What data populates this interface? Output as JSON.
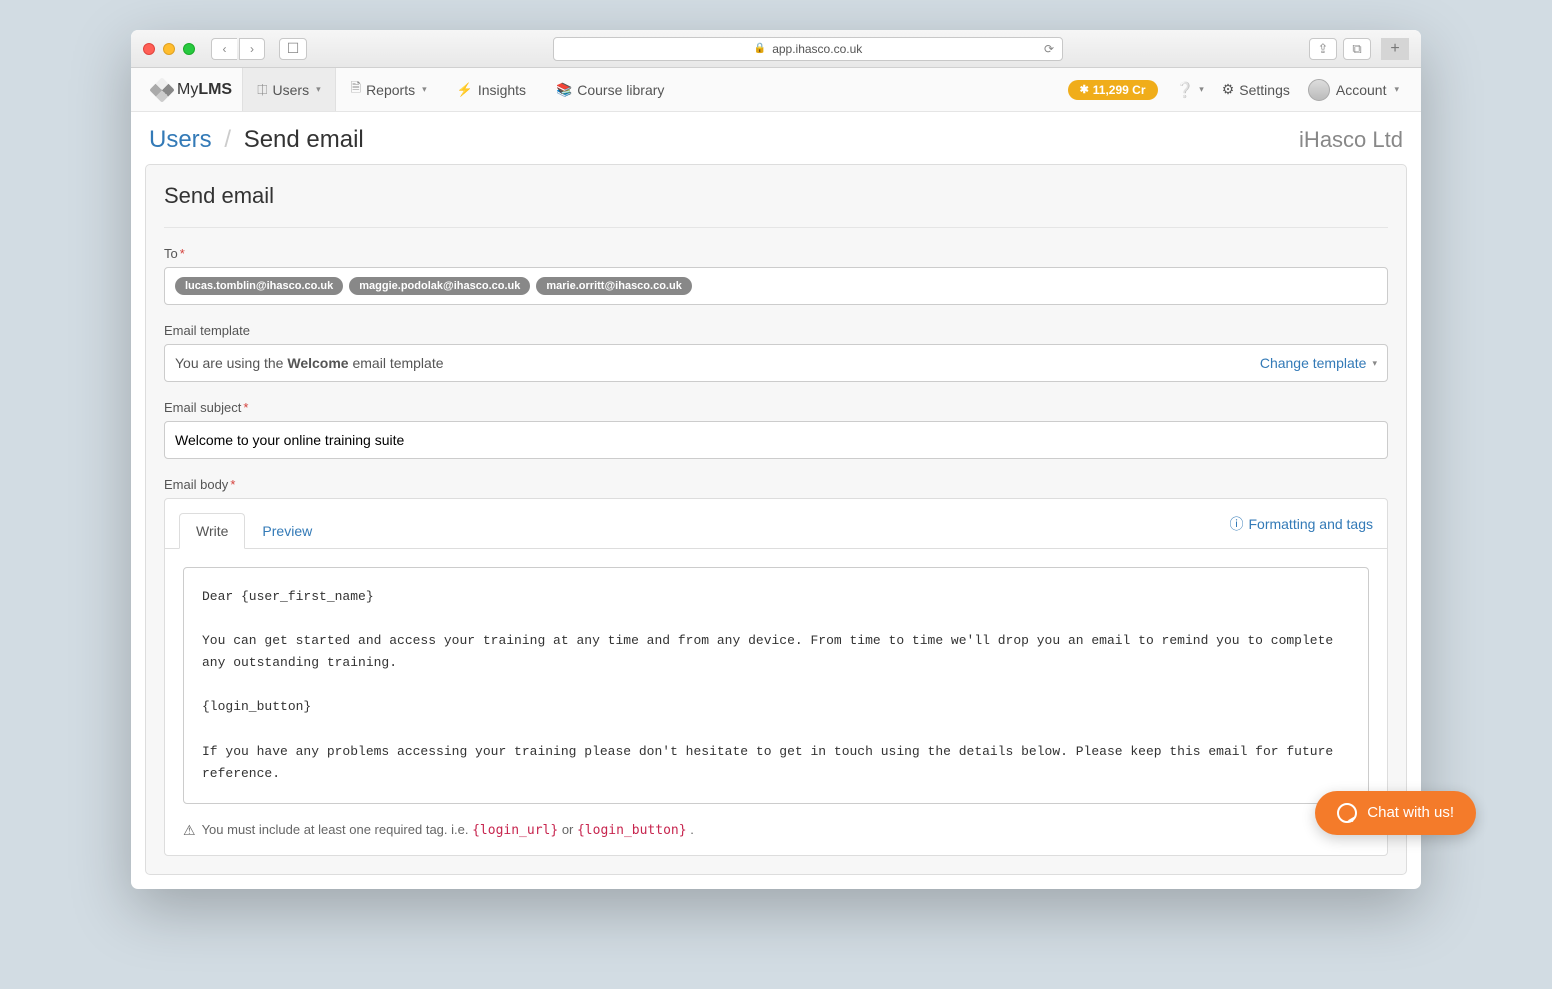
{
  "browser": {
    "url": "app.ihasco.co.uk"
  },
  "nav": {
    "brand_prefix": "My",
    "brand_bold": "LMS",
    "items": [
      {
        "label": "Users",
        "active": true,
        "caret": true,
        "icon": "⎅"
      },
      {
        "label": "Reports",
        "active": false,
        "caret": true,
        "icon": "🗎"
      },
      {
        "label": "Insights",
        "active": false,
        "caret": false,
        "icon": "⚡"
      },
      {
        "label": "Course library",
        "active": false,
        "caret": false,
        "icon": "📚"
      }
    ],
    "credits": "11,299 Cr",
    "settings": "Settings",
    "account": "Account"
  },
  "breadcrumb": {
    "link": "Users",
    "current": "Send email"
  },
  "company": "iHasco Ltd",
  "panel": {
    "title": "Send email",
    "to_label": "To",
    "to_chips": [
      "lucas.tomblin@ihasco.co.uk",
      "maggie.podolak@ihasco.co.uk",
      "marie.orritt@ihasco.co.uk"
    ],
    "template_label": "Email template",
    "template_text_pre": "You are using the ",
    "template_name": "Welcome",
    "template_text_post": " email template",
    "change_template": "Change template",
    "subject_label": "Email subject",
    "subject_value": "Welcome to your online training suite",
    "body_label": "Email body",
    "tabs": {
      "write": "Write",
      "preview": "Preview"
    },
    "format_link": "Formatting and tags",
    "body_value": "Dear {user_first_name}\n\nYou can get started and access your training at any time and from any device. From time to time we'll drop you an email to remind you to complete any outstanding training.\n\n{login_button}\n\nIf you have any problems accessing your training please don't hesitate to get in touch using the details below. Please keep this email for future reference.",
    "hint_pre": "You must include at least one required tag. i.e. ",
    "hint_tag1": "{login_url}",
    "hint_or": " or ",
    "hint_tag2": "{login_button}",
    "hint_post": "."
  },
  "chat": "Chat with us!"
}
